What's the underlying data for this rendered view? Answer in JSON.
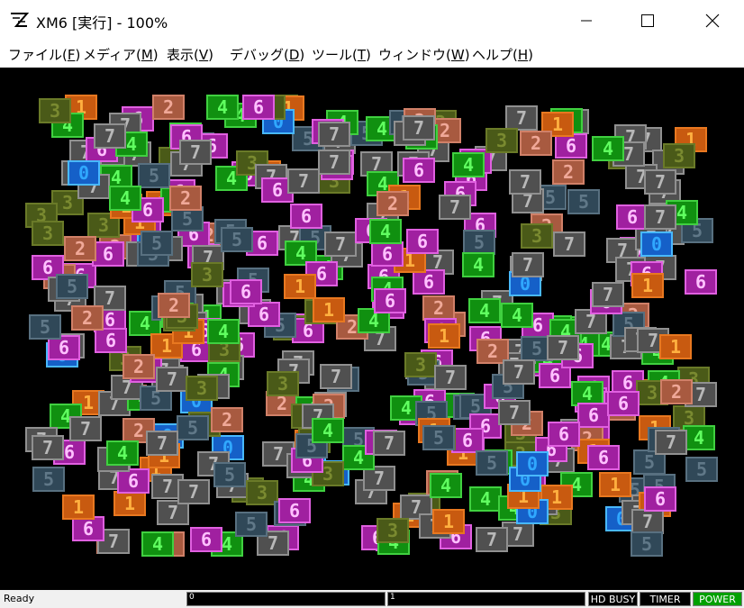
{
  "window": {
    "title": "XM6 [実行] - 100%",
    "icon": "xm6-logo-icon"
  },
  "menu": [
    {
      "label": "ファイル(",
      "accel": "F",
      "end": ")"
    },
    {
      "label": "メディア(",
      "accel": "M",
      "end": ")"
    },
    {
      "label": "表示(",
      "accel": "V",
      "end": ")"
    },
    {
      "label": "デバッグ(",
      "accel": "D",
      "end": ")"
    },
    {
      "label": "ツール(",
      "accel": "T",
      "end": ")"
    },
    {
      "label": "ウィンドウ(",
      "accel": "W",
      "end": ")"
    },
    {
      "label": "ヘルプ(",
      "accel": "H",
      "end": ")"
    }
  ],
  "tile_palette": {
    "0": {
      "bg": "#1560c8",
      "fg": "#30a8ff",
      "border": "#48b8ff"
    },
    "1": {
      "bg": "#c85a10",
      "fg": "#ffb040",
      "border": "#e87820"
    },
    "2": {
      "bg": "#a85a40",
      "fg": "#f0a898",
      "border": "#d08068"
    },
    "3": {
      "bg": "#4a5a18",
      "fg": "#7a8a30",
      "border": "#6a7a28"
    },
    "4": {
      "bg": "#109010",
      "fg": "#60ff60",
      "border": "#40d040"
    },
    "5": {
      "bg": "#304858",
      "fg": "#607888",
      "border": "#587080"
    },
    "6": {
      "bg": "#a020a0",
      "fg": "#ffc0ff",
      "border": "#e060e0"
    },
    "7": {
      "bg": "#505050",
      "fg": "#b8b8b8",
      "border": "#909090"
    }
  },
  "status": {
    "ready": "Ready",
    "drive0": "0",
    "drive1": "1",
    "hd_busy": "HD BUSY",
    "timer": "TIMER",
    "power": "POWER",
    "power_color": "#00a000"
  }
}
